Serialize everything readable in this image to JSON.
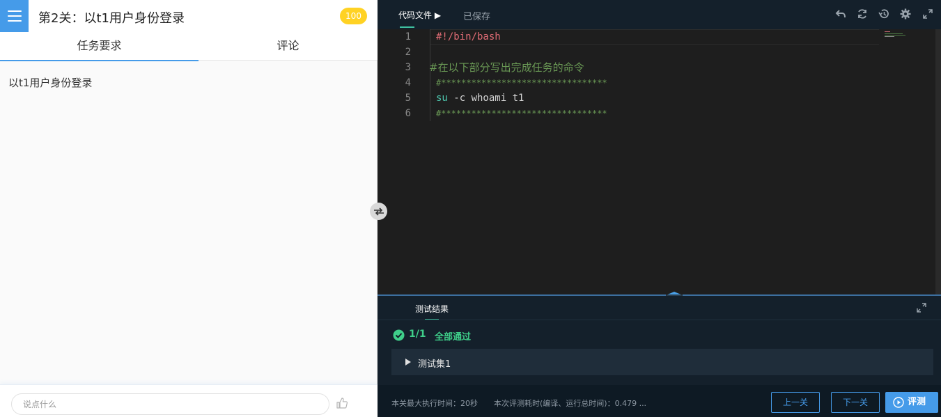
{
  "left": {
    "title": "第2关：以t1用户身份登录",
    "score": "100",
    "tabs": [
      {
        "label": "任务要求"
      },
      {
        "label": "评论"
      }
    ],
    "task_text": "以t1用户身份登录",
    "comment_placeholder": "说点什么"
  },
  "editor": {
    "file_tab": "代码文件 ▶",
    "saved_status": "已保存",
    "toolbar_icons": [
      "undo-icon",
      "refresh-icon",
      "restore-icon",
      "settings-icon",
      "fullscreen-icon"
    ],
    "lines": [
      {
        "n": "1",
        "text": "#!/bin/bash",
        "color": "#e06c75"
      },
      {
        "n": "2",
        "text": "",
        "color": "#d4d4d4"
      },
      {
        "n": "3",
        "text": "#在以下部分写出完成任务的命令",
        "color": "#6a9955"
      },
      {
        "n": "4",
        "text": "#*********************************",
        "color": "#6a9955"
      },
      {
        "n": "5",
        "text": "su -c whoami t1",
        "color": "#d4d4d4"
      },
      {
        "n": "6",
        "text": "#*********************************",
        "color": "#6a9955"
      }
    ]
  },
  "results": {
    "tab_label": "测试结果",
    "pass_count": "1/1",
    "pass_text": "全部通过",
    "testset_label": "测试集1"
  },
  "bottom": {
    "max_time": "本关最大执行时间：20秒",
    "eval_time": "本次评测耗时(编译、运行总时间)：0.479 ...",
    "prev_label": "上一关",
    "next_label": "下一关",
    "eval_label": "评测"
  },
  "colors": {
    "accent": "#459be9",
    "pass_green": "#3fcf8a",
    "score_yellow": "#ffd224"
  }
}
